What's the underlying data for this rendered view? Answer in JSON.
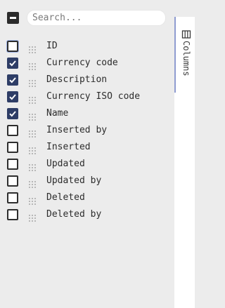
{
  "search": {
    "placeholder": "Search..."
  },
  "columns_tab": {
    "label": "Columns",
    "icon": "columns-icon"
  },
  "columns": [
    {
      "label": "ID",
      "checked": false
    },
    {
      "label": "Currency code",
      "checked": true
    },
    {
      "label": "Description",
      "checked": true
    },
    {
      "label": "Currency ISO code",
      "checked": true
    },
    {
      "label": "Name",
      "checked": true
    },
    {
      "label": "Inserted by",
      "checked": false
    },
    {
      "label": "Inserted",
      "checked": false
    },
    {
      "label": "Updated",
      "checked": false
    },
    {
      "label": "Updated by",
      "checked": false
    },
    {
      "label": "Deleted",
      "checked": false
    },
    {
      "label": "Deleted by",
      "checked": false
    }
  ],
  "colors": {
    "accent": "#2e3d66",
    "tab_border": "#8f9cd0",
    "panel_bg": "#ececec"
  }
}
